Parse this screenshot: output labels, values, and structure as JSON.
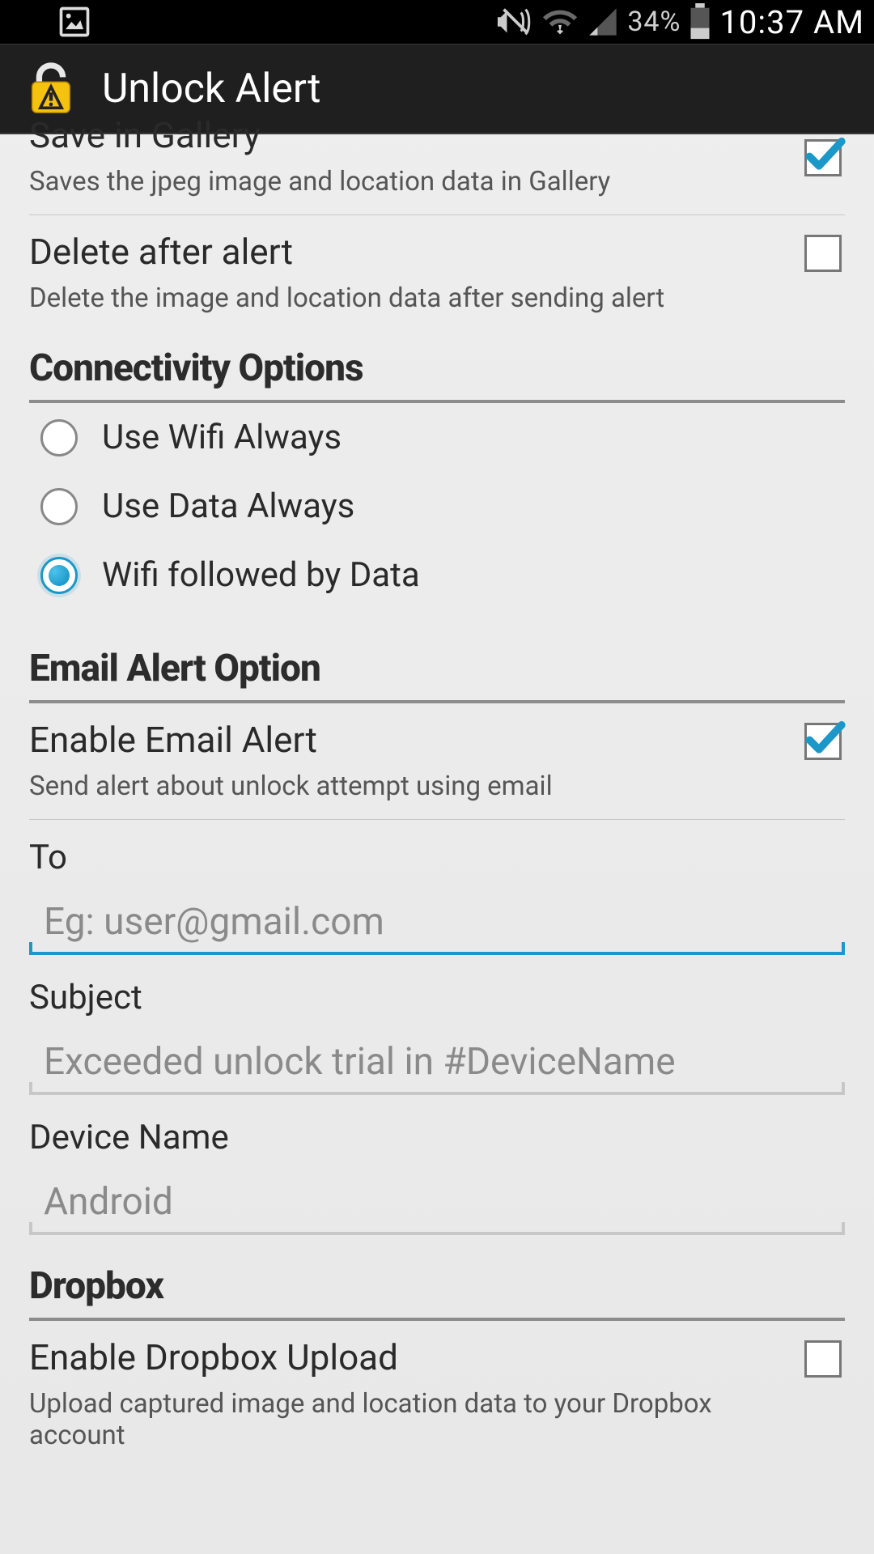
{
  "status": {
    "battery_pct": "34%",
    "time": "10:37 AM"
  },
  "app": {
    "title": "Unlock Alert"
  },
  "save_gallery": {
    "title": "Save in Gallery",
    "subtitle": "Saves the jpeg image and location data in Gallery",
    "checked": true
  },
  "delete_after": {
    "title": "Delete after alert",
    "subtitle": "Delete the image and location data after sending alert",
    "checked": false
  },
  "connectivity": {
    "header": "Connectivity Options",
    "options": [
      {
        "label": "Use Wifi Always",
        "selected": false
      },
      {
        "label": "Use Data Always",
        "selected": false
      },
      {
        "label": "Wifi followed by Data",
        "selected": true
      }
    ]
  },
  "email": {
    "header": "Email Alert Option",
    "enable": {
      "title": "Enable Email Alert",
      "subtitle": "Send alert about unlock attempt using email",
      "checked": true
    },
    "to": {
      "label": "To",
      "placeholder": "Eg: user@gmail.com",
      "value": ""
    },
    "subject": {
      "label": "Subject",
      "placeholder": "Exceeded unlock trial in #DeviceName",
      "value": ""
    },
    "device": {
      "label": "Device Name",
      "placeholder": "Android",
      "value": ""
    }
  },
  "dropbox": {
    "header": "Dropbox",
    "enable": {
      "title": "Enable Dropbox Upload",
      "subtitle": "Upload captured image and location data to your Dropbox account",
      "checked": false
    }
  }
}
